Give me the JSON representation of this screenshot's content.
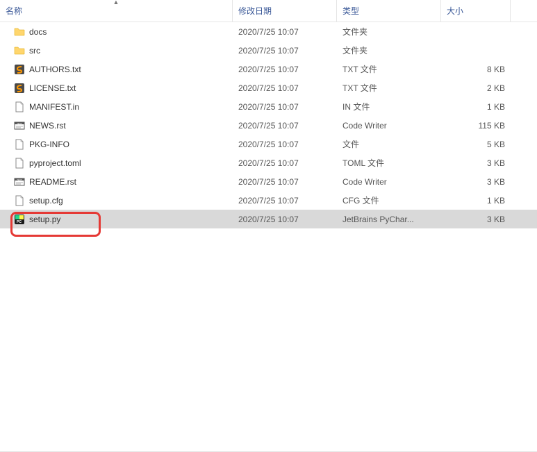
{
  "columns": {
    "name": "名称",
    "date": "修改日期",
    "type": "类型",
    "size": "大小"
  },
  "files": [
    {
      "icon": "folder",
      "name": "docs",
      "date": "2020/7/25 10:07",
      "type": "文件夹",
      "size": ""
    },
    {
      "icon": "folder",
      "name": "src",
      "date": "2020/7/25 10:07",
      "type": "文件夹",
      "size": ""
    },
    {
      "icon": "sublime",
      "name": "AUTHORS.txt",
      "date": "2020/7/25 10:07",
      "type": "TXT 文件",
      "size": "8 KB"
    },
    {
      "icon": "sublime",
      "name": "LICENSE.txt",
      "date": "2020/7/25 10:07",
      "type": "TXT 文件",
      "size": "2 KB"
    },
    {
      "icon": "file",
      "name": "MANIFEST.in",
      "date": "2020/7/25 10:07",
      "type": "IN 文件",
      "size": "1 KB"
    },
    {
      "icon": "text",
      "name": "NEWS.rst",
      "date": "2020/7/25 10:07",
      "type": "Code Writer",
      "size": "115 KB"
    },
    {
      "icon": "file",
      "name": "PKG-INFO",
      "date": "2020/7/25 10:07",
      "type": "文件",
      "size": "5 KB"
    },
    {
      "icon": "file",
      "name": "pyproject.toml",
      "date": "2020/7/25 10:07",
      "type": "TOML 文件",
      "size": "3 KB"
    },
    {
      "icon": "text",
      "name": "README.rst",
      "date": "2020/7/25 10:07",
      "type": "Code Writer",
      "size": "3 KB"
    },
    {
      "icon": "file",
      "name": "setup.cfg",
      "date": "2020/7/25 10:07",
      "type": "CFG 文件",
      "size": "1 KB"
    },
    {
      "icon": "pycharm",
      "name": "setup.py",
      "date": "2020/7/25 10:07",
      "type": "JetBrains PyChar...",
      "size": "3 KB",
      "selected": true
    }
  ]
}
